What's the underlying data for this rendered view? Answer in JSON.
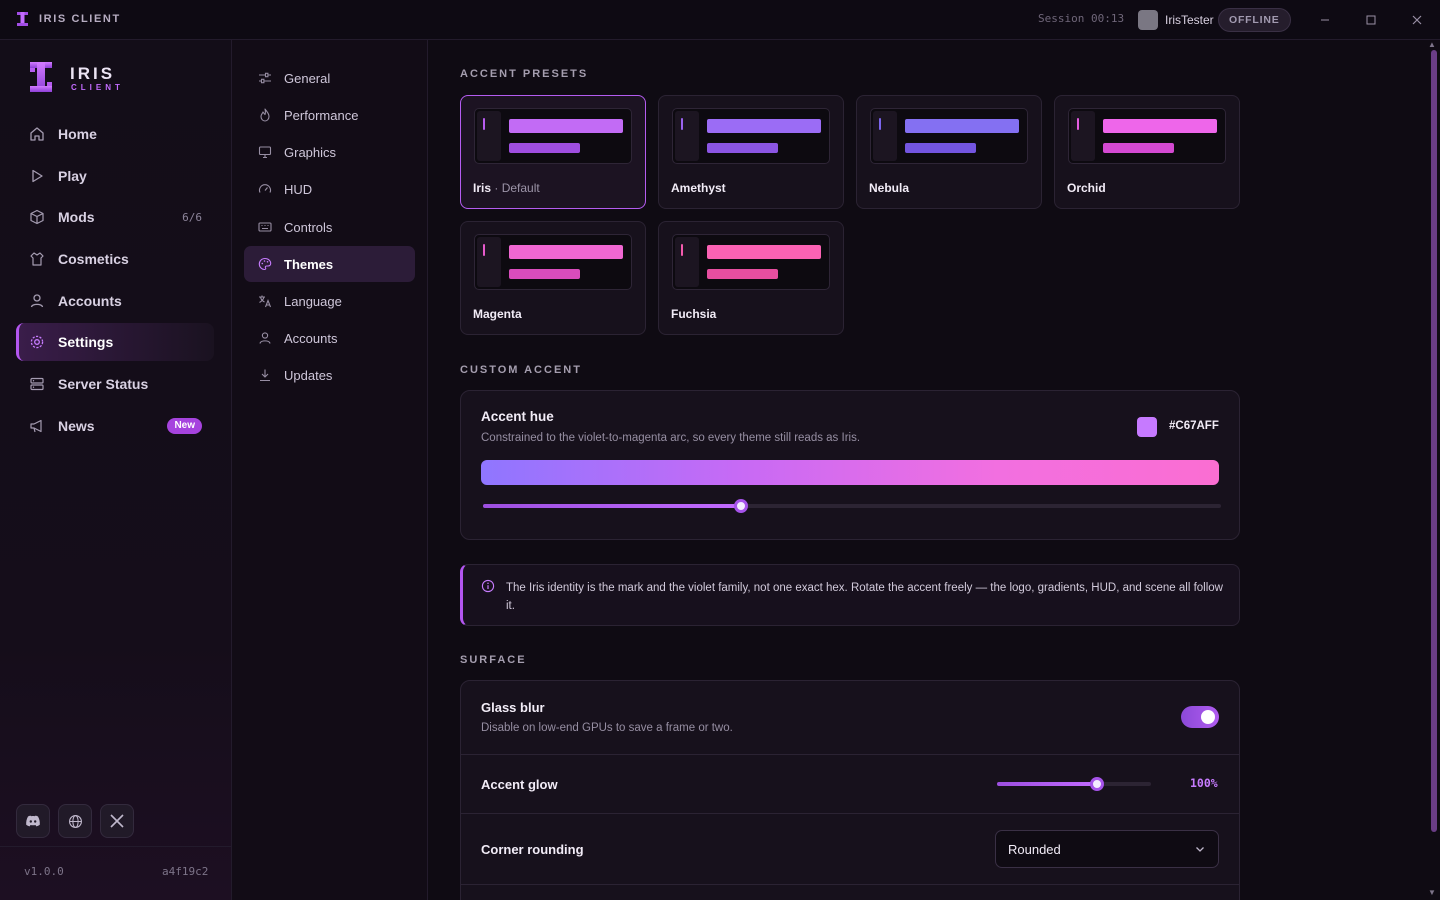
{
  "titlebar": {
    "app_title": "IRIS CLIENT",
    "session": "Session 00:13",
    "username": "IrisTester",
    "status_badge": "OFFLINE"
  },
  "sidebar": {
    "brand_name": "IRIS",
    "brand_sub": "CLIENT",
    "items": [
      {
        "label": "Home",
        "icon": "home-icon"
      },
      {
        "label": "Play",
        "icon": "play-icon"
      },
      {
        "label": "Mods",
        "icon": "box-icon",
        "count": "6/6"
      },
      {
        "label": "Cosmetics",
        "icon": "shirt-icon"
      },
      {
        "label": "Accounts",
        "icon": "user-icon"
      },
      {
        "label": "Settings",
        "icon": "gear-icon",
        "active": true
      },
      {
        "label": "Server Status",
        "icon": "server-icon"
      },
      {
        "label": "News",
        "icon": "megaphone-icon",
        "badge": "New"
      }
    ],
    "social": [
      "discord-icon",
      "globe-icon",
      "x-icon"
    ],
    "version": "v1.0.0",
    "build_hash": "a4f19c2"
  },
  "settings_nav": {
    "items": [
      {
        "label": "General",
        "icon": "sliders-icon"
      },
      {
        "label": "Performance",
        "icon": "flame-icon"
      },
      {
        "label": "Graphics",
        "icon": "monitor-icon"
      },
      {
        "label": "HUD",
        "icon": "gauge-icon"
      },
      {
        "label": "Controls",
        "icon": "keyboard-icon"
      },
      {
        "label": "Themes",
        "icon": "palette-icon",
        "active": true
      },
      {
        "label": "Language",
        "icon": "translate-icon"
      },
      {
        "label": "Accounts",
        "icon": "user-icon"
      },
      {
        "label": "Updates",
        "icon": "download-icon"
      }
    ]
  },
  "accent_presets": {
    "title": "ACCENT PRESETS",
    "presets": [
      {
        "name": "Iris",
        "sub": "· Default",
        "active": true,
        "bar1": "#c26bf5",
        "bar2": "#9f4ee0",
        "tick": "#b85cf0"
      },
      {
        "name": "Amethyst",
        "sub": "",
        "bar1": "#9b6cf5",
        "bar2": "#8b55e3",
        "tick": "#9a62ee"
      },
      {
        "name": "Nebula",
        "sub": "",
        "bar1": "#8470f2",
        "bar2": "#7355e0",
        "tick": "#7b65ec"
      },
      {
        "name": "Orchid",
        "sub": "",
        "bar1": "#ee66ea",
        "bar2": "#d449d2",
        "tick": "#e45ce0"
      },
      {
        "name": "Magenta",
        "sub": "",
        "bar1": "#f067d2",
        "bar2": "#d94cbc",
        "tick": "#e65acb"
      },
      {
        "name": "Fuchsia",
        "sub": "",
        "bar1": "#fb62b4",
        "bar2": "#e74ea0",
        "tick": "#f35aad"
      }
    ]
  },
  "custom_accent": {
    "title": "CUSTOM ACCENT",
    "hue_title": "Accent hue",
    "hue_desc": "Constrained to the violet-to-magenta arc, so every theme still reads as Iris.",
    "hex": "#C67AFF",
    "slider_fraction": 0.35
  },
  "note": {
    "text": "The Iris identity is the mark and the violet family, not one exact hex. Rotate the accent freely — the logo, gradients, HUD, and scene all follow it."
  },
  "surface": {
    "title": "SURFACE",
    "glass_blur_title": "Glass blur",
    "glass_blur_desc": "Disable on low-end GPUs to save a frame or two.",
    "glass_blur_on": true,
    "accent_glow_title": "Accent glow",
    "accent_glow_value": "100%",
    "accent_glow_fraction": 0.65,
    "corner_title": "Corner rounding",
    "corner_value": "Rounded"
  },
  "colors": {
    "accent": "#C67AFF",
    "background": "#0f0b14"
  }
}
